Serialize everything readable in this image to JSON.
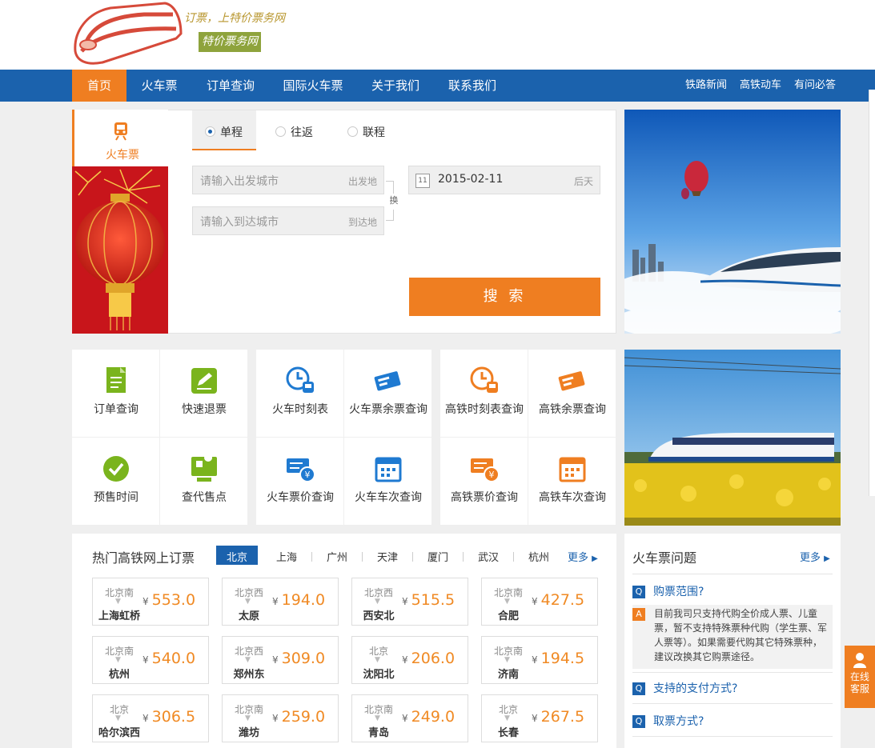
{
  "brand": {
    "slogan": "订票，上特价票务网",
    "name": "特价票务网"
  },
  "nav": {
    "items": [
      "首页",
      "火车票",
      "订单查询",
      "国际火车票",
      "关于我们",
      "联系我们"
    ],
    "right": [
      "铁路新闻",
      "高铁动车",
      "有问必答"
    ]
  },
  "booking": {
    "side_tab": "火车票",
    "trip_types": [
      "单程",
      "往返",
      "联程"
    ],
    "from_placeholder": "请输入出发城市",
    "from_suffix": "出发地",
    "to_placeholder": "请输入到达城市",
    "to_suffix": "到达地",
    "swap": "换",
    "date_icon_day": "11",
    "date": "2015-02-11",
    "date_hint": "后天",
    "search": "搜 索"
  },
  "quick": [
    {
      "label": "订单查询",
      "icon": "document-icon"
    },
    {
      "label": "快速退票",
      "icon": "edit-icon"
    },
    {
      "label": "预售时间",
      "icon": "check-icon"
    },
    {
      "label": "查代售点",
      "icon": "map-pin-icon"
    },
    {
      "label": "火车时刻表",
      "icon": "clock-train-icon"
    },
    {
      "label": "火车票余票查询",
      "icon": "tickets-icon"
    },
    {
      "label": "火车票价查询",
      "icon": "ticket-price-icon"
    },
    {
      "label": "火车车次查询",
      "icon": "calendar-icon"
    },
    {
      "label": "高铁时刻表查询",
      "icon": "clock-train-icon"
    },
    {
      "label": "高铁余票查询",
      "icon": "tickets-icon"
    },
    {
      "label": "高铁票价查询",
      "icon": "ticket-price-icon"
    },
    {
      "label": "高铁车次查询",
      "icon": "calendar-icon"
    }
  ],
  "hot": {
    "title": "热门高铁网上订票",
    "cities": [
      "北京",
      "上海",
      "广州",
      "天津",
      "厦门",
      "武汉",
      "杭州"
    ],
    "more": "更多",
    "currency": "¥",
    "routes": [
      {
        "from": "北京南",
        "to": "上海虹桥",
        "price": "553.0"
      },
      {
        "from": "北京西",
        "to": "太原",
        "price": "194.0"
      },
      {
        "from": "北京西",
        "to": "西安北",
        "price": "515.5"
      },
      {
        "from": "北京南",
        "to": "合肥",
        "price": "427.5"
      },
      {
        "from": "北京南",
        "to": "杭州",
        "price": "540.0"
      },
      {
        "from": "北京西",
        "to": "郑州东",
        "price": "309.0"
      },
      {
        "from": "北京",
        "to": "沈阳北",
        "price": "206.0"
      },
      {
        "from": "北京南",
        "to": "济南",
        "price": "194.5"
      },
      {
        "from": "北京",
        "to": "哈尔滨西",
        "price": "306.5"
      },
      {
        "from": "北京南",
        "to": "潍坊",
        "price": "259.0"
      },
      {
        "from": "北京南",
        "to": "青岛",
        "price": "249.0"
      },
      {
        "from": "北京",
        "to": "长春",
        "price": "267.5"
      }
    ]
  },
  "faq": {
    "title": "火车票问题",
    "more": "更多",
    "q1": "购票范围?",
    "a1": "目前我司只支持代购全价成人票、儿童票，暂不支持特殊票种代购（学生票、军人票等）。如果需要代购其它特殊票种，建议改换其它购票途径。",
    "q2": "支持的支付方式?",
    "q3": "取票方式?",
    "q_label": "Q",
    "a_label": "A"
  },
  "online": {
    "label": "在线客服"
  },
  "colors": {
    "nav": "#1b62ad",
    "accent": "#f08a24",
    "active_tab": "#ef7e21"
  }
}
